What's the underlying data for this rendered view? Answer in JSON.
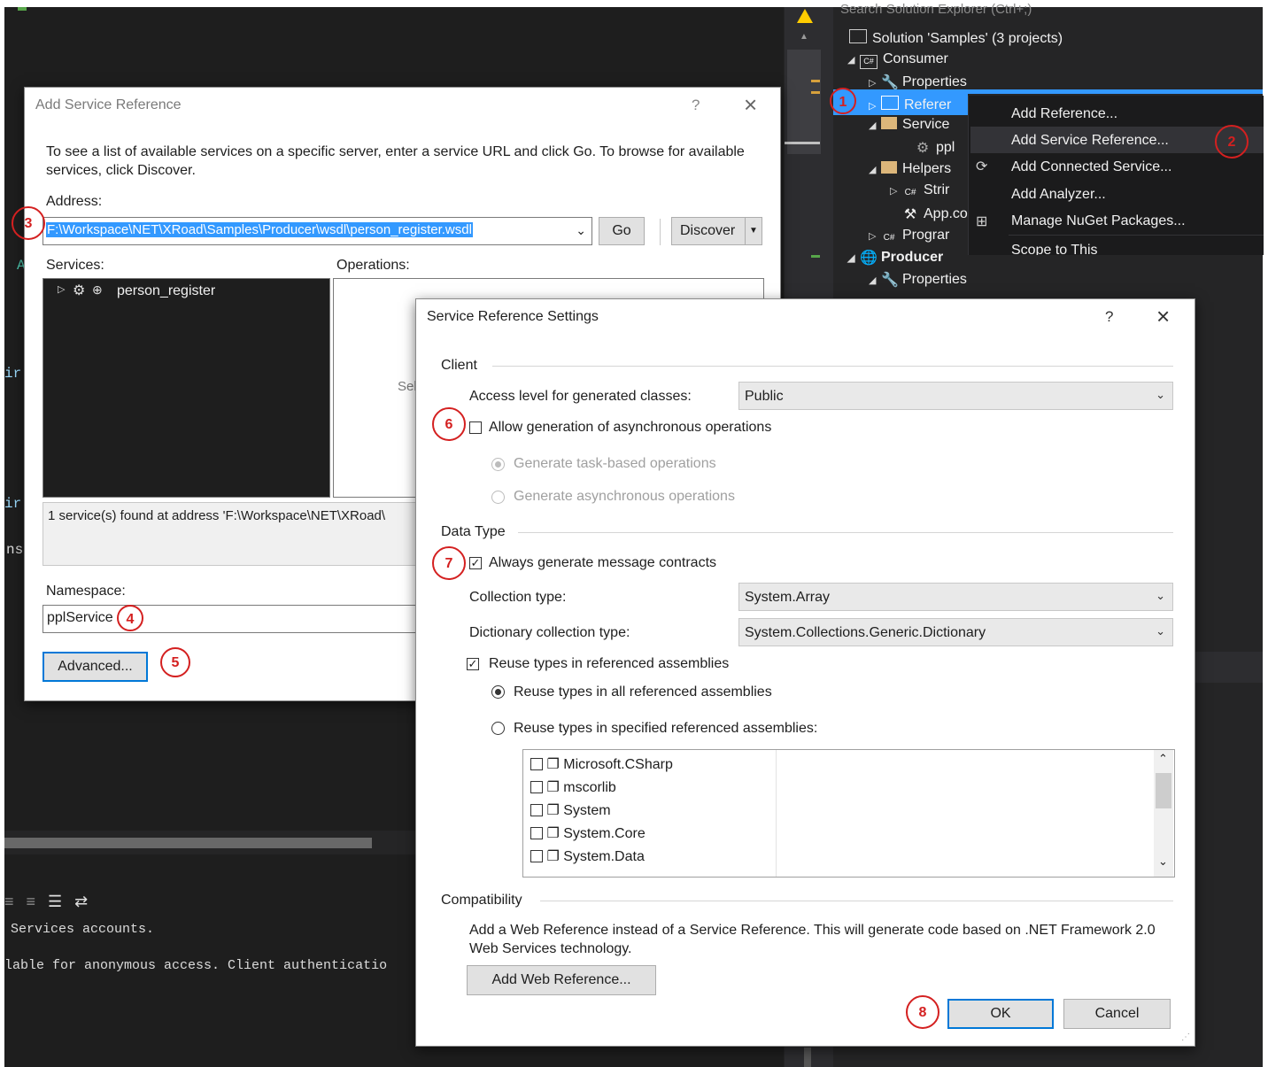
{
  "ide": {
    "code_fragments": [
      "A",
      "ir",
      "ir",
      "ns"
    ],
    "output_lines": [
      "Services accounts.",
      "lable for anonymous access. Client authenticatio"
    ]
  },
  "solution_explorer": {
    "search_placeholder": "Search Solution Explorer (Ctrl+;)",
    "items": [
      {
        "label": "Solution 'Samples' (3 projects)",
        "icon": "solution-icon"
      },
      {
        "label": "Consumer",
        "icon": "csharp-project-icon"
      },
      {
        "label": "Properties",
        "icon": "wrench-icon"
      },
      {
        "label": "Referer",
        "icon": "references-icon"
      },
      {
        "label": "Service",
        "icon": "folder-icon"
      },
      {
        "label": "ppl",
        "icon": "service-icon"
      },
      {
        "label": "Helpers",
        "icon": "folder-icon"
      },
      {
        "label": "Strir",
        "icon": "csharp-file-icon"
      },
      {
        "label": "App.co",
        "icon": "config-icon"
      },
      {
        "label": "Prograr",
        "icon": "csharp-file-icon"
      },
      {
        "label": "Producer",
        "icon": "web-project-icon"
      },
      {
        "label": "Properties",
        "icon": "wrench-icon"
      }
    ]
  },
  "context_menu": {
    "items": [
      {
        "label": "Add Reference...",
        "icon": ""
      },
      {
        "label": "Add Service Reference...",
        "icon": ""
      },
      {
        "label": "Add Connected Service...",
        "icon": "connected-service-icon"
      },
      {
        "label": "Add Analyzer...",
        "icon": ""
      },
      {
        "label": "Manage NuGet Packages...",
        "icon": "nuget-icon"
      },
      {
        "label": "Scope to This",
        "icon": ""
      }
    ]
  },
  "add_service_dialog": {
    "title": "Add Service Reference",
    "help": "?",
    "close": "×",
    "instructions": "To see a list of available services on a specific server, enter a service URL and click Go. To browse for available services, click Discover.",
    "address_label": "Address:",
    "address_value": "F:\\Workspace\\NET\\XRoad\\Samples\\Producer\\wsdl\\person_register.wsdl",
    "go_label": "Go",
    "discover_label": "Discover",
    "services_label": "Services:",
    "operations_label": "Operations:",
    "service_item": "person_register",
    "operations_hint": "Sel",
    "status_text": "1 service(s) found at address 'F:\\Workspace\\NET\\XRoad\\",
    "namespace_label": "Namespace:",
    "namespace_value": "pplService",
    "advanced_label": "Advanced..."
  },
  "settings_dialog": {
    "title": "Service Reference Settings",
    "help": "?",
    "close": "×",
    "client_group": "Client",
    "access_level_label": "Access level for generated classes:",
    "access_level_value": "Public",
    "allow_async_label": "Allow generation of asynchronous operations",
    "allow_async_checked": false,
    "task_based_label": "Generate task-based operations",
    "async_ops_label": "Generate asynchronous operations",
    "data_type_group": "Data Type",
    "message_contracts_label": "Always generate message contracts",
    "message_contracts_checked": true,
    "collection_type_label": "Collection type:",
    "collection_type_value": "System.Array",
    "dictionary_type_label": "Dictionary collection type:",
    "dictionary_type_value": "System.Collections.Generic.Dictionary",
    "reuse_types_label": "Reuse types in referenced assemblies",
    "reuse_types_checked": true,
    "reuse_all_label": "Reuse types in all referenced assemblies",
    "reuse_specified_label": "Reuse types in specified referenced assemblies:",
    "assemblies": [
      "Microsoft.CSharp",
      "mscorlib",
      "System",
      "System.Core",
      "System.Data"
    ],
    "compat_group": "Compatibility",
    "compat_text": "Add a Web Reference instead of a Service Reference. This will generate code based on .NET Framework 2.0 Web Services technology.",
    "add_web_ref_label": "Add Web Reference...",
    "ok_label": "OK",
    "cancel_label": "Cancel"
  },
  "step_markers": [
    "1",
    "2",
    "3",
    "4",
    "5",
    "6",
    "7",
    "8"
  ],
  "colors": {
    "ide_dark": "#252526",
    "editor_dark": "#1e1e1e",
    "highlight_blue": "#007acc",
    "selection_blue": "#3399ff",
    "marker_red": "#d42020",
    "warning_yellow": "#ffcc00"
  }
}
